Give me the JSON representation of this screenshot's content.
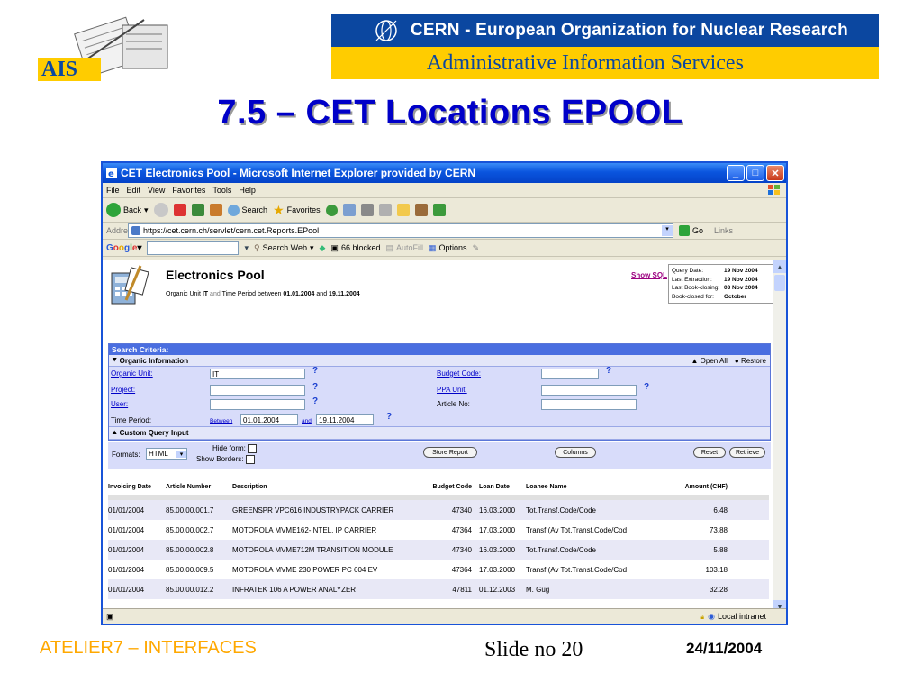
{
  "slide": {
    "logo_text": "AIS",
    "org_name": "CERN - European Organization for Nuclear Research",
    "dept_name": "Administrative Information Services",
    "title": "7.5 – CET Locations EPOOL",
    "footer_left": "ATELIER7 – INTERFACES",
    "footer_mid": "Slide no 20",
    "footer_right": "24/11/2004"
  },
  "browser": {
    "title": "CET Electronics Pool - Microsoft Internet Explorer provided by CERN",
    "menu": [
      "File",
      "Edit",
      "View",
      "Favorites",
      "Tools",
      "Help"
    ],
    "toolbar": {
      "back": "Back",
      "search": "Search",
      "favorites": "Favorites"
    },
    "address_label": "Address",
    "address": "https://cet.cern.ch/servlet/cern.cet.Reports.EPool",
    "go": "Go",
    "links": "Links",
    "google": {
      "search_web": "Search Web",
      "blocked": "66 blocked",
      "autofill": "AutoFill",
      "options": "Options"
    },
    "status": {
      "zone": "Local intranet"
    }
  },
  "app": {
    "title": "Electronics Pool",
    "subtitle_prefix": "Organic Unit",
    "unit": "IT",
    "and1": "and",
    "period_text": "Time Period between",
    "from": "01.01.2004",
    "and2": "and",
    "to": "19.11.2004",
    "show_sql": "Show SQL",
    "query_info": [
      {
        "k": "Query Date:",
        "v": "19 Nov 2004"
      },
      {
        "k": "Last Extraction:",
        "v": "19 Nov 2004"
      },
      {
        "k": "Last Book-closing:",
        "v": "03 Nov 2004"
      },
      {
        "k": "Book-closed for:",
        "v": "October"
      }
    ]
  },
  "criteria": {
    "header": "Search Criteria:",
    "org_header": "Organic Information",
    "open_all": "Open All",
    "restore": "Restore",
    "organic_unit_label": "Organic Unit:",
    "organic_unit_value": "IT",
    "project_label": "Project:",
    "user_label": "User:",
    "time_period_label": "Time Period:",
    "between": "Between",
    "from": "01.01.2004",
    "and": "and",
    "to": "19.11.2004",
    "budget_code_label": "Budget Code:",
    "ppa_unit_label": "PPA Unit:",
    "article_no_label": "Article No:",
    "help": "?",
    "custom_query": "Custom Query Input",
    "formats_label": "Formats:",
    "formats_value": "HTML",
    "hide_form": "Hide form:",
    "show_borders": "Show Borders:",
    "store_report": "Store Report",
    "columns": "Columns",
    "reset": "Reset",
    "retrieve": "Retrieve"
  },
  "table": {
    "headers": [
      "Invoicing Date",
      "Article Number",
      "Description",
      "Budget Code",
      "Loan Date",
      "Loanee Name",
      "Amount (CHF)"
    ],
    "rows": [
      [
        "01/01/2004",
        "85.00.00.001.7",
        "GREENSPR VPC616 INDUSTRYPACK CARRIER",
        "47340",
        "16.03.2000",
        "Tot.Transf.Code/Code",
        "6.48"
      ],
      [
        "01/01/2004",
        "85.00.00.002.7",
        "MOTOROLA MVME162-INTEL. IP CARRIER",
        "47364",
        "17.03.2000",
        "Transf (Av Tot.Transf.Code/Cod",
        "73.88"
      ],
      [
        "01/01/2004",
        "85.00.00.002.8",
        "MOTOROLA MVME712M TRANSITION MODULE",
        "47340",
        "16.03.2000",
        "Tot.Transf.Code/Code",
        "5.88"
      ],
      [
        "01/01/2004",
        "85.00.00.009.5",
        "MOTOROLA MVME 230 POWER PC 604 EV",
        "47364",
        "17.03.2000",
        "Transf (Av Tot.Transf.Code/Cod",
        "103.18"
      ],
      [
        "01/01/2004",
        "85.00.00.012.2",
        "INFRATEK 106 A POWER ANALYZER",
        "47811",
        "01.12.2003",
        "M. Gug",
        "32.28"
      ]
    ]
  }
}
